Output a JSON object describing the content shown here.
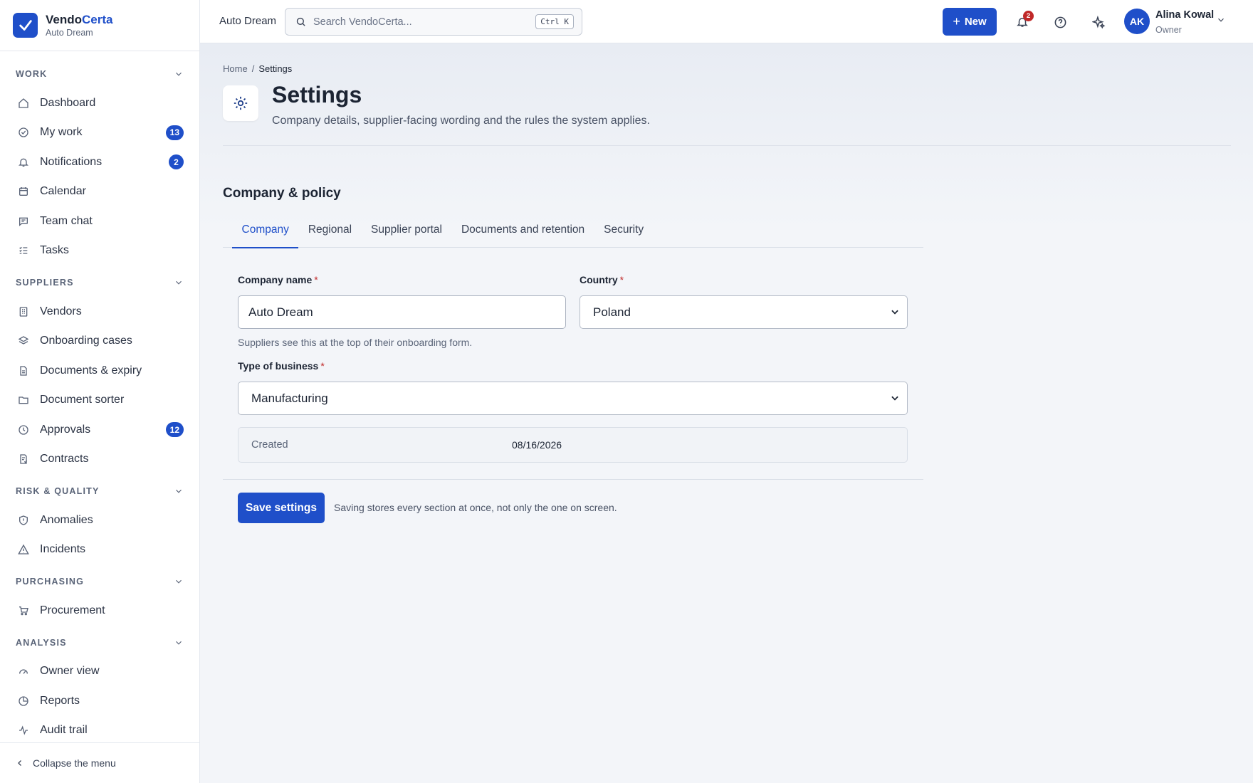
{
  "brand": {
    "name_part1": "Vendo",
    "name_part2": "Certa",
    "org": "Auto Dream"
  },
  "sidebar": {
    "sections": [
      {
        "label": "WORK",
        "items": [
          {
            "label": "Dashboard",
            "icon": "home-icon"
          },
          {
            "label": "My work",
            "icon": "check-circle-icon",
            "badge": "13"
          },
          {
            "label": "Notifications",
            "icon": "bell-icon",
            "badge": "2"
          },
          {
            "label": "Calendar",
            "icon": "calendar-icon"
          },
          {
            "label": "Team chat",
            "icon": "chat-icon"
          },
          {
            "label": "Tasks",
            "icon": "list-icon"
          }
        ]
      },
      {
        "label": "SUPPLIERS",
        "items": [
          {
            "label": "Vendors",
            "icon": "building-icon"
          },
          {
            "label": "Onboarding cases",
            "icon": "layers-icon"
          },
          {
            "label": "Documents & expiry",
            "icon": "document-icon"
          },
          {
            "label": "Document sorter",
            "icon": "folder-icon"
          },
          {
            "label": "Approvals",
            "icon": "clock-icon",
            "badge": "12"
          },
          {
            "label": "Contracts",
            "icon": "contract-icon"
          }
        ]
      },
      {
        "label": "RISK & QUALITY",
        "items": [
          {
            "label": "Anomalies",
            "icon": "shield-icon"
          },
          {
            "label": "Incidents",
            "icon": "warning-icon"
          }
        ]
      },
      {
        "label": "PURCHASING",
        "items": [
          {
            "label": "Procurement",
            "icon": "cart-icon"
          }
        ]
      },
      {
        "label": "ANALYSIS",
        "items": [
          {
            "label": "Owner view",
            "icon": "gauge-icon"
          },
          {
            "label": "Reports",
            "icon": "pie-chart-icon"
          },
          {
            "label": "Audit trail",
            "icon": "activity-icon"
          }
        ]
      }
    ],
    "collapse_label": "Collapse the menu"
  },
  "topbar": {
    "org": "Auto Dream",
    "search_placeholder": "Search VendoCerta...",
    "search_shortcut": "Ctrl K",
    "new_label": "New",
    "notification_count": "2",
    "user": {
      "initials": "AK",
      "name": "Alina Kowal",
      "role": "Owner"
    }
  },
  "page": {
    "breadcrumb": {
      "home": "Home",
      "sep": "/",
      "current": "Settings"
    },
    "title": "Settings",
    "subtitle": "Company details, supplier-facing wording and the rules the system applies.",
    "section_title": "Company & policy",
    "tabs": [
      "Company",
      "Regional",
      "Supplier portal",
      "Documents and retention",
      "Security"
    ],
    "active_tab": "Company",
    "form": {
      "company_name_label": "Company name",
      "company_name_value": "Auto Dream",
      "company_name_hint": "Suppliers see this at the top of their onboarding form.",
      "country_label": "Country",
      "country_value": "Poland",
      "business_type_label": "Type of business",
      "business_type_value": "Manufacturing",
      "required_mark": "*",
      "created_label": "Created",
      "created_value": "08/16/2026"
    },
    "save_label": "Save settings",
    "save_note": "Saving stores every section at once, not only the one on screen."
  },
  "colors": {
    "accent": "#1f4fc9",
    "danger": "#c02828",
    "background": "#f3f5f9"
  }
}
